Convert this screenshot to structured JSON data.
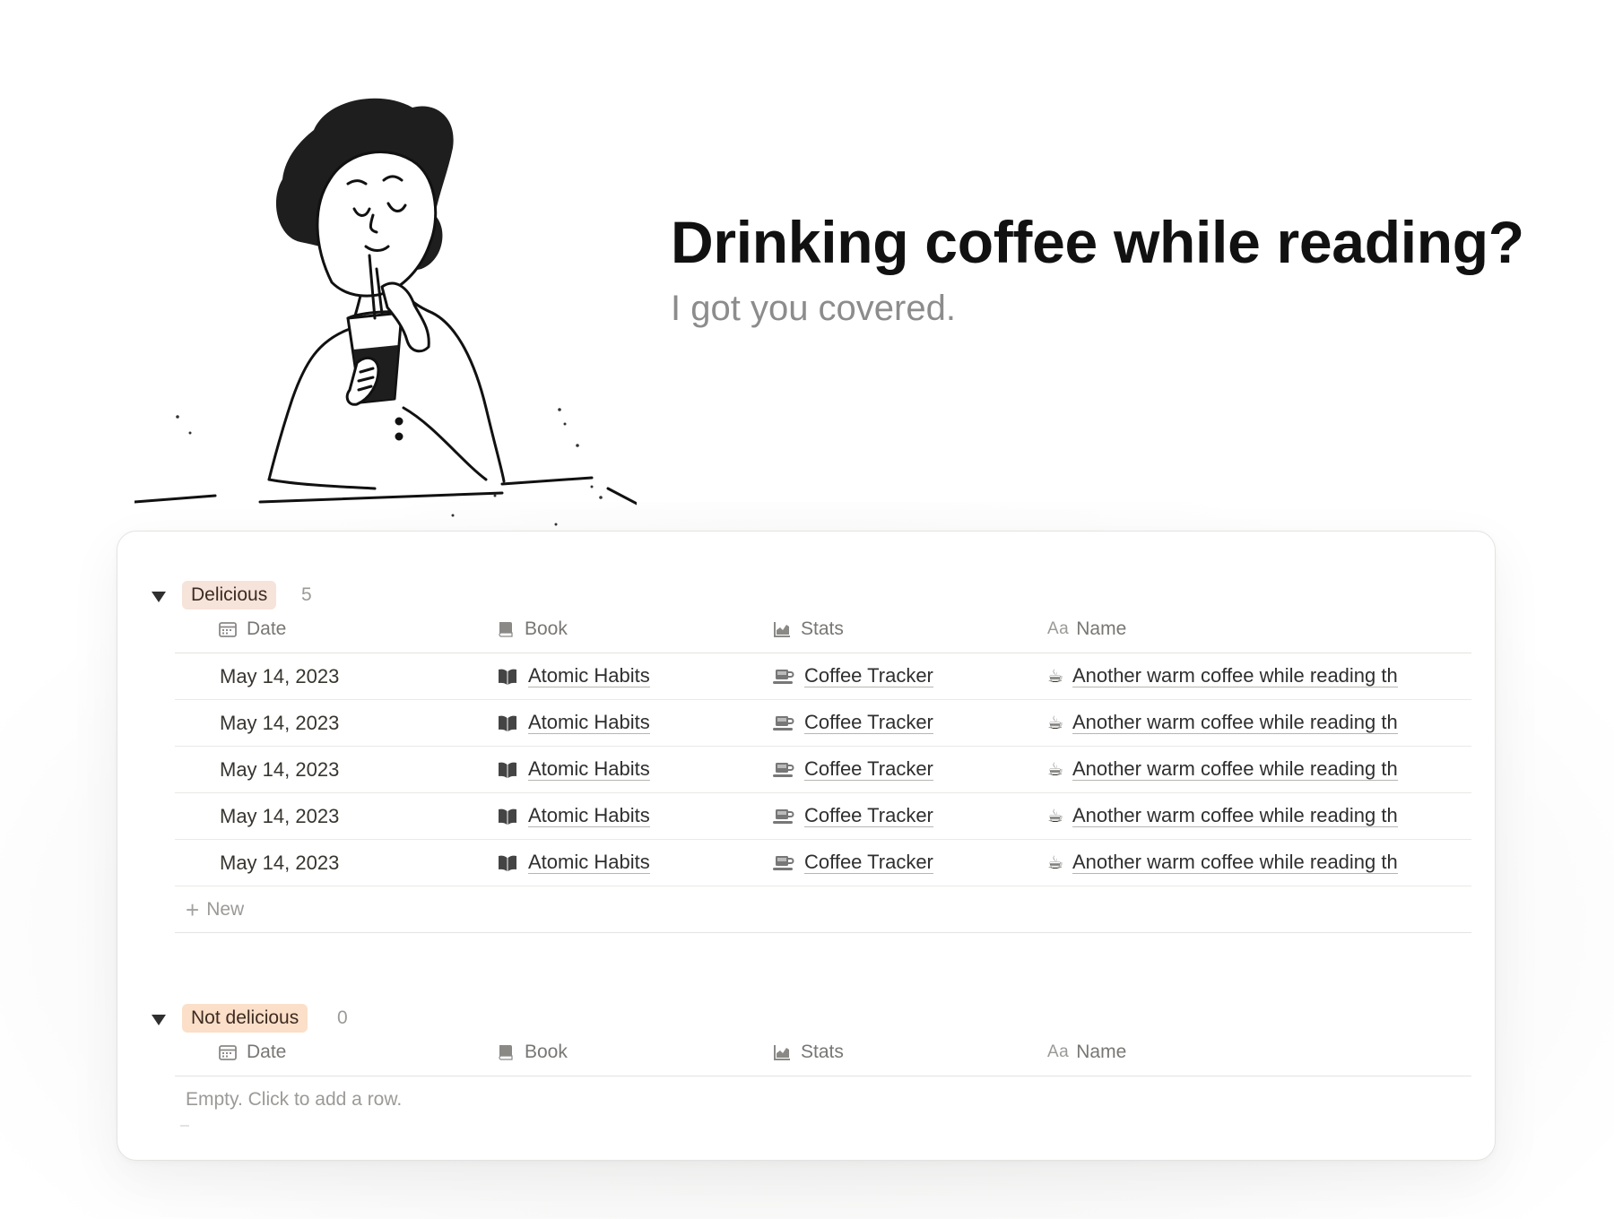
{
  "hero": {
    "title": "Drinking coffee while reading?",
    "subtitle": "I got you covered."
  },
  "icons": {
    "date": "calendar-icon",
    "book": "book-icon",
    "stats": "chart-icon",
    "name": "text-aa-icon",
    "row_book": "open-book-icon",
    "row_stats": "coffee-cup-icon",
    "row_name": "hot-beverage-icon"
  },
  "columns": {
    "date": "Date",
    "book": "Book",
    "stats": "Stats",
    "name_prefix": "Aa",
    "name": "Name"
  },
  "groups": [
    {
      "tag": "Delicious",
      "tag_color": "#f6e3da",
      "count": "5",
      "rows": [
        {
          "date": "May 14, 2023",
          "book": "Atomic Habits",
          "stats": "Coffee Tracker",
          "emoji": "☕",
          "name": "Another warm coffee while reading th"
        },
        {
          "date": "May 14, 2023",
          "book": "Atomic Habits",
          "stats": "Coffee Tracker",
          "emoji": "☕",
          "name": "Another warm coffee while reading th"
        },
        {
          "date": "May 14, 2023",
          "book": "Atomic Habits",
          "stats": "Coffee Tracker",
          "emoji": "☕",
          "name": "Another warm coffee while reading th"
        },
        {
          "date": "May 14, 2023",
          "book": "Atomic Habits",
          "stats": "Coffee Tracker",
          "emoji": "☕",
          "name": "Another warm coffee while reading th"
        },
        {
          "date": "May 14, 2023",
          "book": "Atomic Habits",
          "stats": "Coffee Tracker",
          "emoji": "☕",
          "name": "Another warm coffee while reading th"
        }
      ],
      "new_label": "New"
    },
    {
      "tag": "Not delicious",
      "tag_color": "#fbdfc8",
      "count": "0",
      "empty_label": "Empty. Click to add a row."
    }
  ]
}
